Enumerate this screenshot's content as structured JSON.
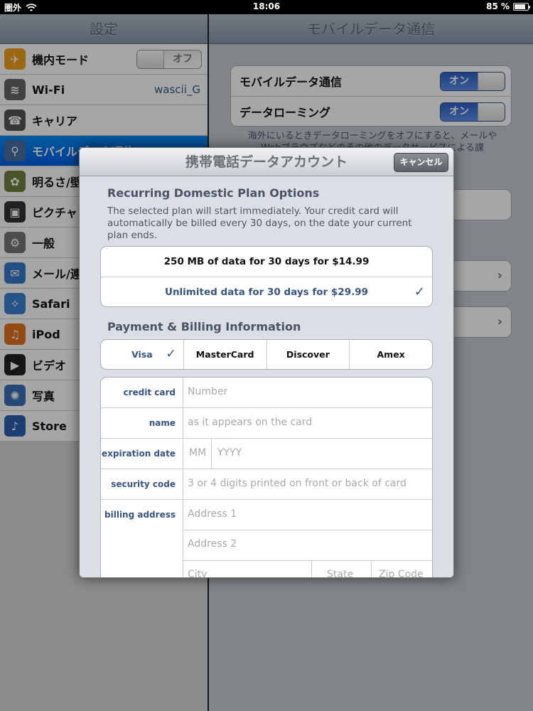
{
  "status": {
    "carrier": "圏外",
    "time": "18:06",
    "battery": "85 %",
    "battery_level": 0.85
  },
  "left": {
    "title": "設定",
    "items": [
      {
        "label": "機内モード",
        "icon": "airplane-icon",
        "color": "#f0a020",
        "switch": "オフ"
      },
      {
        "label": "Wi-Fi",
        "icon": "wifi-icon",
        "color": "#666666",
        "value": "wascii_G"
      },
      {
        "label": "キャリア",
        "icon": "phone-icon",
        "color": "#555555"
      },
      {
        "label": "モバイルデータ通信",
        "icon": "antenna-icon",
        "color": "#4a6fa0",
        "selected": true
      },
      {
        "label": "明るさ/壁紙",
        "icon": "flower-icon",
        "color": "#708040"
      },
      {
        "label": "ピクチャフレーム",
        "icon": "frame-icon",
        "color": "#333333"
      },
      {
        "label": "一般",
        "icon": "gear-icon",
        "color": "#777777"
      },
      {
        "label": "メール/連絡先/カレンダー",
        "icon": "mail-icon",
        "color": "#3a78c8"
      },
      {
        "label": "Safari",
        "icon": "compass-icon",
        "color": "#3a80d0"
      },
      {
        "label": "iPod",
        "icon": "ipod-icon",
        "color": "#e07020"
      },
      {
        "label": "ビデオ",
        "icon": "video-icon",
        "color": "#222222"
      },
      {
        "label": "写真",
        "icon": "sunflower-icon",
        "color": "#3a6fb8"
      },
      {
        "label": "Store",
        "icon": "store-icon",
        "color": "#2a5fb0"
      }
    ]
  },
  "right": {
    "title": "モバイルデータ通信",
    "toggles": [
      {
        "label": "モバイルデータ通信",
        "switch": "オン"
      },
      {
        "label": "データローミング",
        "switch": "オン"
      }
    ],
    "note": "海外にいるときデータローミングをオフにすると、メールやWebブラウズなどのその他のデータサービスによる課"
  },
  "modal": {
    "title": "携帯電話データアカウント",
    "cancel": "キャンセル",
    "plans_title": "Recurring Domestic Plan Options",
    "plans_desc": "The selected plan will start immediately. Your credit card will automatically be billed every 30 days, on the date your current plan ends.",
    "plans": [
      {
        "label": "250 MB of data for 30 days for $14.99",
        "selected": false
      },
      {
        "label": "Unlimited data for 30 days for $29.99",
        "selected": true
      }
    ],
    "payment_title": "Payment & Billing Information",
    "cards": [
      {
        "label": "Visa",
        "selected": true
      },
      {
        "label": "MasterCard",
        "selected": false
      },
      {
        "label": "Discover",
        "selected": false
      },
      {
        "label": "Amex",
        "selected": false
      }
    ],
    "form": {
      "credit_card_label": "credit card",
      "credit_card_ph": "Number",
      "name_label": "name",
      "name_ph": "as it appears on the card",
      "exp_label": "expiration date",
      "exp_mm_ph": "MM",
      "exp_yyyy_ph": "YYYY",
      "sec_label": "security code",
      "sec_ph": "3 or 4 digits printed on front or back of card",
      "billing_label": "billing address",
      "addr1_ph": "Address 1",
      "addr2_ph": "Address 2",
      "city_ph": "City",
      "state_ph": "State",
      "zip_ph": "Zip Code"
    }
  }
}
